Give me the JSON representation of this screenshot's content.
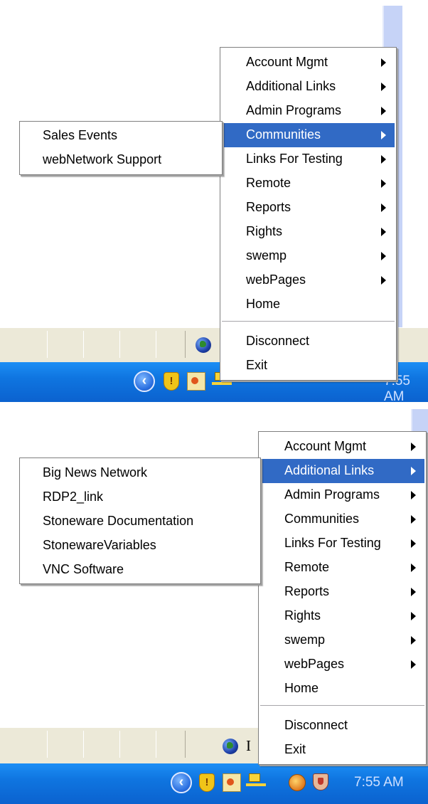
{
  "screen1": {
    "main_menu": {
      "items": [
        {
          "label": "Account Mgmt",
          "submenu": true,
          "highlighted": false
        },
        {
          "label": "Additional Links",
          "submenu": true,
          "highlighted": false
        },
        {
          "label": "Admin Programs",
          "submenu": true,
          "highlighted": false
        },
        {
          "label": "Communities",
          "submenu": true,
          "highlighted": true
        },
        {
          "label": "Links For Testing",
          "submenu": true,
          "highlighted": false
        },
        {
          "label": "Remote",
          "submenu": true,
          "highlighted": false
        },
        {
          "label": "Reports",
          "submenu": true,
          "highlighted": false
        },
        {
          "label": "Rights",
          "submenu": true,
          "highlighted": false
        },
        {
          "label": "swemp",
          "submenu": true,
          "highlighted": false
        },
        {
          "label": "webPages",
          "submenu": true,
          "highlighted": false
        },
        {
          "label": "Home",
          "submenu": false,
          "highlighted": false
        }
      ],
      "footer_items": [
        {
          "label": "Disconnect"
        },
        {
          "label": "Exit"
        }
      ]
    },
    "submenu": {
      "parent": "Communities",
      "items": [
        {
          "label": "Sales Events"
        },
        {
          "label": "webNetwork Support"
        }
      ]
    },
    "tray": {
      "clock": "7:55 AM"
    }
  },
  "screen2": {
    "main_menu": {
      "items": [
        {
          "label": "Account Mgmt",
          "submenu": true,
          "highlighted": false
        },
        {
          "label": "Additional Links",
          "submenu": true,
          "highlighted": true
        },
        {
          "label": "Admin Programs",
          "submenu": true,
          "highlighted": false
        },
        {
          "label": "Communities",
          "submenu": true,
          "highlighted": false
        },
        {
          "label": "Links For Testing",
          "submenu": true,
          "highlighted": false
        },
        {
          "label": "Remote",
          "submenu": true,
          "highlighted": false
        },
        {
          "label": "Reports",
          "submenu": true,
          "highlighted": false
        },
        {
          "label": "Rights",
          "submenu": true,
          "highlighted": false
        },
        {
          "label": "swemp",
          "submenu": true,
          "highlighted": false
        },
        {
          "label": "webPages",
          "submenu": true,
          "highlighted": false
        },
        {
          "label": "Home",
          "submenu": false,
          "highlighted": false
        }
      ],
      "footer_items": [
        {
          "label": "Disconnect"
        },
        {
          "label": "Exit"
        }
      ]
    },
    "submenu": {
      "parent": "Additional Links",
      "items": [
        {
          "label": "Big News Network"
        },
        {
          "label": "RDP2_link"
        },
        {
          "label": "Stoneware Documentation"
        },
        {
          "label": "StonewareVariables"
        },
        {
          "label": "VNC Software"
        }
      ]
    },
    "taskbar_fragment": "I",
    "tray": {
      "clock": "7:55 AM"
    }
  },
  "colors": {
    "highlight": "#316ac5",
    "taskbar": "#ece9d8",
    "tray": "#0f75e0",
    "window_edge": "#c6d3f7"
  }
}
